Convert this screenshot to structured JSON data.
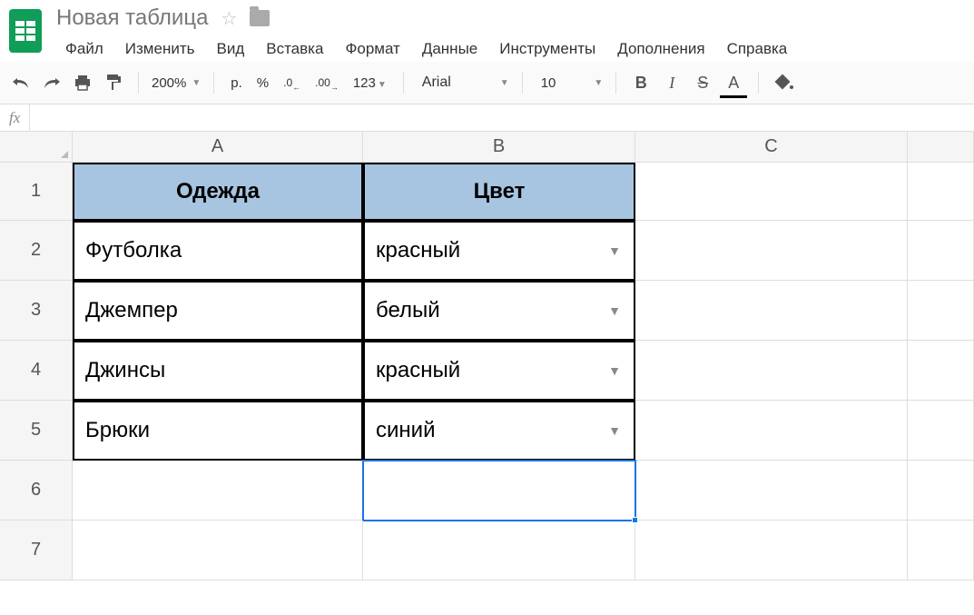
{
  "title": "Новая таблица",
  "menu": {
    "file": "Файл",
    "edit": "Изменить",
    "view": "Вид",
    "insert": "Вставка",
    "format": "Формат",
    "data": "Данные",
    "tools": "Инструменты",
    "addons": "Дополнения",
    "help": "Справка"
  },
  "toolbar": {
    "zoom": "200%",
    "currency": "р.",
    "percent": "%",
    "dec_dec": ".0",
    "dec_inc": ".00",
    "more_fmt": "123",
    "font": "Arial",
    "font_size": "10",
    "bold": "B",
    "italic": "I",
    "strike": "S",
    "textcolor": "A"
  },
  "formula": {
    "fx": "fx",
    "value": ""
  },
  "columns": {
    "A": "A",
    "B": "B",
    "C": "C"
  },
  "rows": [
    "1",
    "2",
    "3",
    "4",
    "5",
    "6",
    "7"
  ],
  "sheet": {
    "headers": {
      "a": "Одежда",
      "b": "Цвет"
    },
    "data": [
      {
        "a": "Футболка",
        "b": "красный"
      },
      {
        "a": "Джемпер",
        "b": "белый"
      },
      {
        "a": "Джинсы",
        "b": "красный"
      },
      {
        "a": "Брюки",
        "b": "синий"
      }
    ]
  },
  "selected_cell": "B6"
}
